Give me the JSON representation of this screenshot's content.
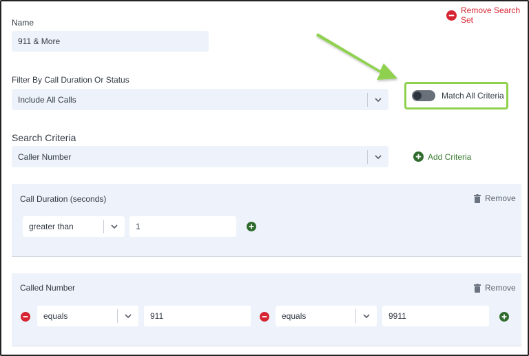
{
  "name": {
    "label": "Name",
    "value": "911 & More"
  },
  "remove_search_set": "Remove Search Set",
  "filter": {
    "label": "Filter By Call Duration Or Status",
    "selected": "Include All Calls"
  },
  "match_all": {
    "label": "Match All Criteria",
    "enabled": false
  },
  "search_criteria": {
    "title": "Search Criteria",
    "selected": "Caller Number",
    "add_label": "Add Criteria"
  },
  "panels": [
    {
      "title": "Call Duration (seconds)",
      "remove_label": "Remove",
      "rows": [
        {
          "operator": "greater than",
          "value": "1"
        }
      ]
    },
    {
      "title": "Called Number",
      "remove_label": "Remove",
      "rows": [
        {
          "operator": "equals",
          "value": "911"
        },
        {
          "operator": "equals",
          "value": "9911"
        }
      ]
    }
  ],
  "colors": {
    "field_bg": "#eef3fb",
    "remove_red": "#d62432",
    "add_green": "#3c7a33",
    "highlight_green": "#8fd14f"
  }
}
